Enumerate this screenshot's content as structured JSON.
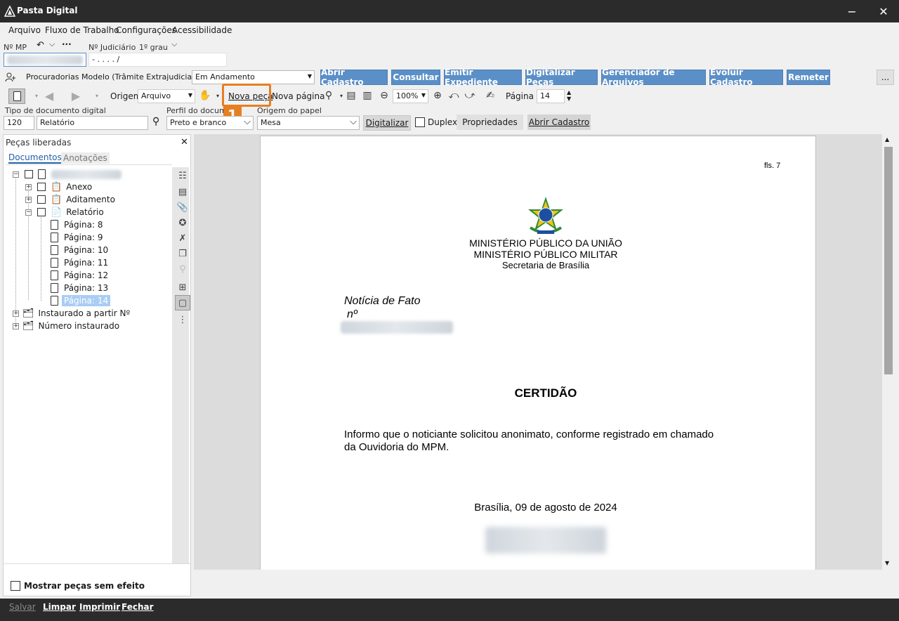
{
  "window": {
    "title": "Pasta Digital",
    "minimize": "−",
    "close": "✕"
  },
  "menu": [
    "Arquivo",
    "Fluxo de Trabalho",
    "Configurações",
    "Acessibilidade"
  ],
  "ids": {
    "mp_label": "Nº MP",
    "judiciario_label": "Nº Judiciário",
    "grau": "1º grau",
    "judiciario_value": "  -  .    .   .   .     /"
  },
  "queue": {
    "label": "Procuradorias Modelo (Trâmite Extrajudicial) - Fila",
    "value": "Em Andamento"
  },
  "actions": [
    "Abrir Cadastro",
    "Consultar",
    "Emitir Expediente",
    "Digitalizar Peças",
    "Gerenciador de Arquivos",
    "Evoluir Cadastro",
    "Remeter"
  ],
  "more_label": "...",
  "toolbar": {
    "origem_label": "Origem",
    "origem_value": "Arquivo",
    "nova_peca": "Nova peça",
    "nova_pagina": "Nova página",
    "zoom": "100%",
    "pagina_label": "Página :",
    "pagina_value": "14",
    "callout": "1"
  },
  "scan": {
    "tipo_label": "Tipo de documento digital",
    "tipo_code": "120",
    "tipo_value": "Relatório",
    "perfil_label": "Perfil do documento",
    "perfil_value": "Preto e branco",
    "origem_papel_label": "Origem do papel",
    "origem_papel_value": "Mesa",
    "digitalizar": "Digitalizar",
    "duplex": "Duplex",
    "propriedades": "Propriedades",
    "abrir_cadastro": "Abrir Cadastro"
  },
  "panel": {
    "title": "Peças liberadas",
    "close": "✕",
    "tabs": [
      "Documentos",
      "Anotações"
    ],
    "tree": [
      {
        "label": "Anexo"
      },
      {
        "label": "Aditamento"
      },
      {
        "label": "Relatório"
      },
      {
        "label": "Página: 8"
      },
      {
        "label": "Página: 9"
      },
      {
        "label": "Página: 10"
      },
      {
        "label": "Página: 11"
      },
      {
        "label": "Página: 12"
      },
      {
        "label": "Página: 13"
      },
      {
        "label": "Página: 14"
      },
      {
        "label": "Instaurado a partir Nº"
      },
      {
        "label": "Número instaurado"
      }
    ],
    "show_no_effect": "Mostrar peças sem efeito"
  },
  "document": {
    "fls": "fls. 7",
    "org1": "MINISTÉRIO PÚBLICO DA UNIÃO",
    "org2": "MINISTÉRIO PÚBLICO MILITAR",
    "org3": "Secretaria de Brasília",
    "noticia": "Notícia de Fato",
    "numero": "nº",
    "heading": "CERTIDÃO",
    "body_line1": "Informo que o noticiante solicitou anonimato, conforme registrado em chamado",
    "body_line2": "da Ouvidoria do MPM.",
    "date": "Brasília, 09 de agosto de 2024"
  },
  "footer": [
    "Salvar",
    "Limpar",
    "Imprimir",
    "Fechar"
  ],
  "colors": {
    "accent": "#5b8fc7",
    "callout": "#e67e22",
    "titlebar": "#2b2b2b"
  }
}
